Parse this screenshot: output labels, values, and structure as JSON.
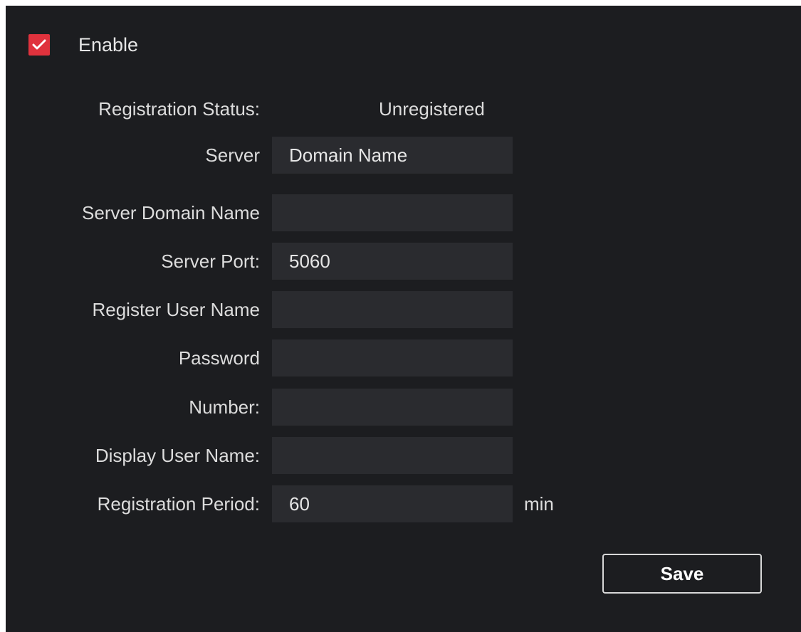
{
  "enable": {
    "label": "Enable",
    "checked": true
  },
  "status": {
    "label": "Registration Status:",
    "value": "Unregistered"
  },
  "fields": {
    "server": {
      "label": "Server",
      "value": "Domain Name"
    },
    "server_domain_name": {
      "label": "Server Domain Name",
      "value": ""
    },
    "server_port": {
      "label": "Server Port:",
      "value": "5060"
    },
    "register_user_name": {
      "label": "Register User Name",
      "value": ""
    },
    "password": {
      "label": "Password",
      "value": ""
    },
    "number": {
      "label": "Number:",
      "value": ""
    },
    "display_user_name": {
      "label": "Display User Name:",
      "value": ""
    },
    "registration_period": {
      "label": "Registration Period:",
      "value": "60",
      "unit": "min"
    }
  },
  "actions": {
    "save_label": "Save"
  },
  "colors": {
    "panel_background": "#1c1d20",
    "input_background": "#2a2b2f",
    "checkbox_accent": "#e0323d",
    "text": "#e6e6e6"
  },
  "icons": {
    "checkbox": "checkmark-icon"
  }
}
